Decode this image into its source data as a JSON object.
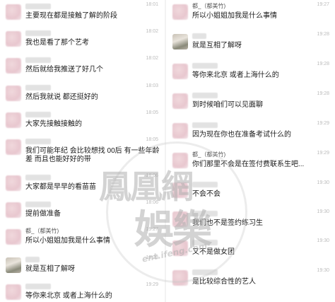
{
  "left_column": [
    {
      "ts": "18:01",
      "text": "主要现在都是接触了解的阶段"
    },
    {
      "ts": "18:02",
      "text": "我也是看了那个艺考"
    },
    {
      "ts": "18:02",
      "text": "然后就给我推送了好几个"
    },
    {
      "ts": "18:03",
      "text": "然后我就说 都还挺好的"
    },
    {
      "ts": "18:05",
      "text": "大家先接触接触的"
    },
    {
      "ts": "18:05",
      "text": "我们可能年纪 会比较想找 00后 有一些年龄差 而且也能好好的带"
    },
    {
      "ts": "18:06",
      "text": "大家都是早早的看苗苗"
    },
    {
      "ts": "18:06",
      "text": "提前做准备"
    },
    {
      "sender_name": "都_（都美竹)",
      "ts": "19:27",
      "text": "所以小姐姐加我是什么事情"
    },
    {
      "ts": "19:28",
      "text": "就是互相了解呀"
    },
    {
      "ts": "19:29",
      "text": "等你来北京 或者上海什么的"
    }
  ],
  "right_column": [
    {
      "sender_name": "都_（都美竹)",
      "ts": "19:27",
      "text": "所以小姐姐加我是什么事情"
    },
    {
      "ts": "19:28",
      "text": "就是互相了解呀"
    },
    {
      "ts": "19:28",
      "text": "等你来北京 或者上海什么的"
    },
    {
      "ts": "19:28",
      "text": "到时候咱们可以见面聊"
    },
    {
      "ts": "19:29",
      "text": "因为现在你也在准备考试什么的"
    },
    {
      "sender_name": "都_（都美竹)",
      "ts": "19:29",
      "text": "你们那里不会是在签付费联系生吧..."
    },
    {
      "ts": "19:30",
      "text": "不会不会"
    },
    {
      "ts": "19:30",
      "text": "我们也不是签约练习生"
    },
    {
      "ts": "19:30",
      "text": "又不是做女团"
    },
    {
      "ts": "19:30",
      "text": "是比较综合性的艺人"
    }
  ],
  "watermark": {
    "line1": "鳳凰網",
    "line2": "娛樂",
    "line3": "ent.ifeng.com"
  },
  "colors": {
    "text": "#1a1a1a",
    "timestamp": "#bbbbbb",
    "avatar_pink": "#e8c7cf",
    "watermark": "#afafaf"
  }
}
